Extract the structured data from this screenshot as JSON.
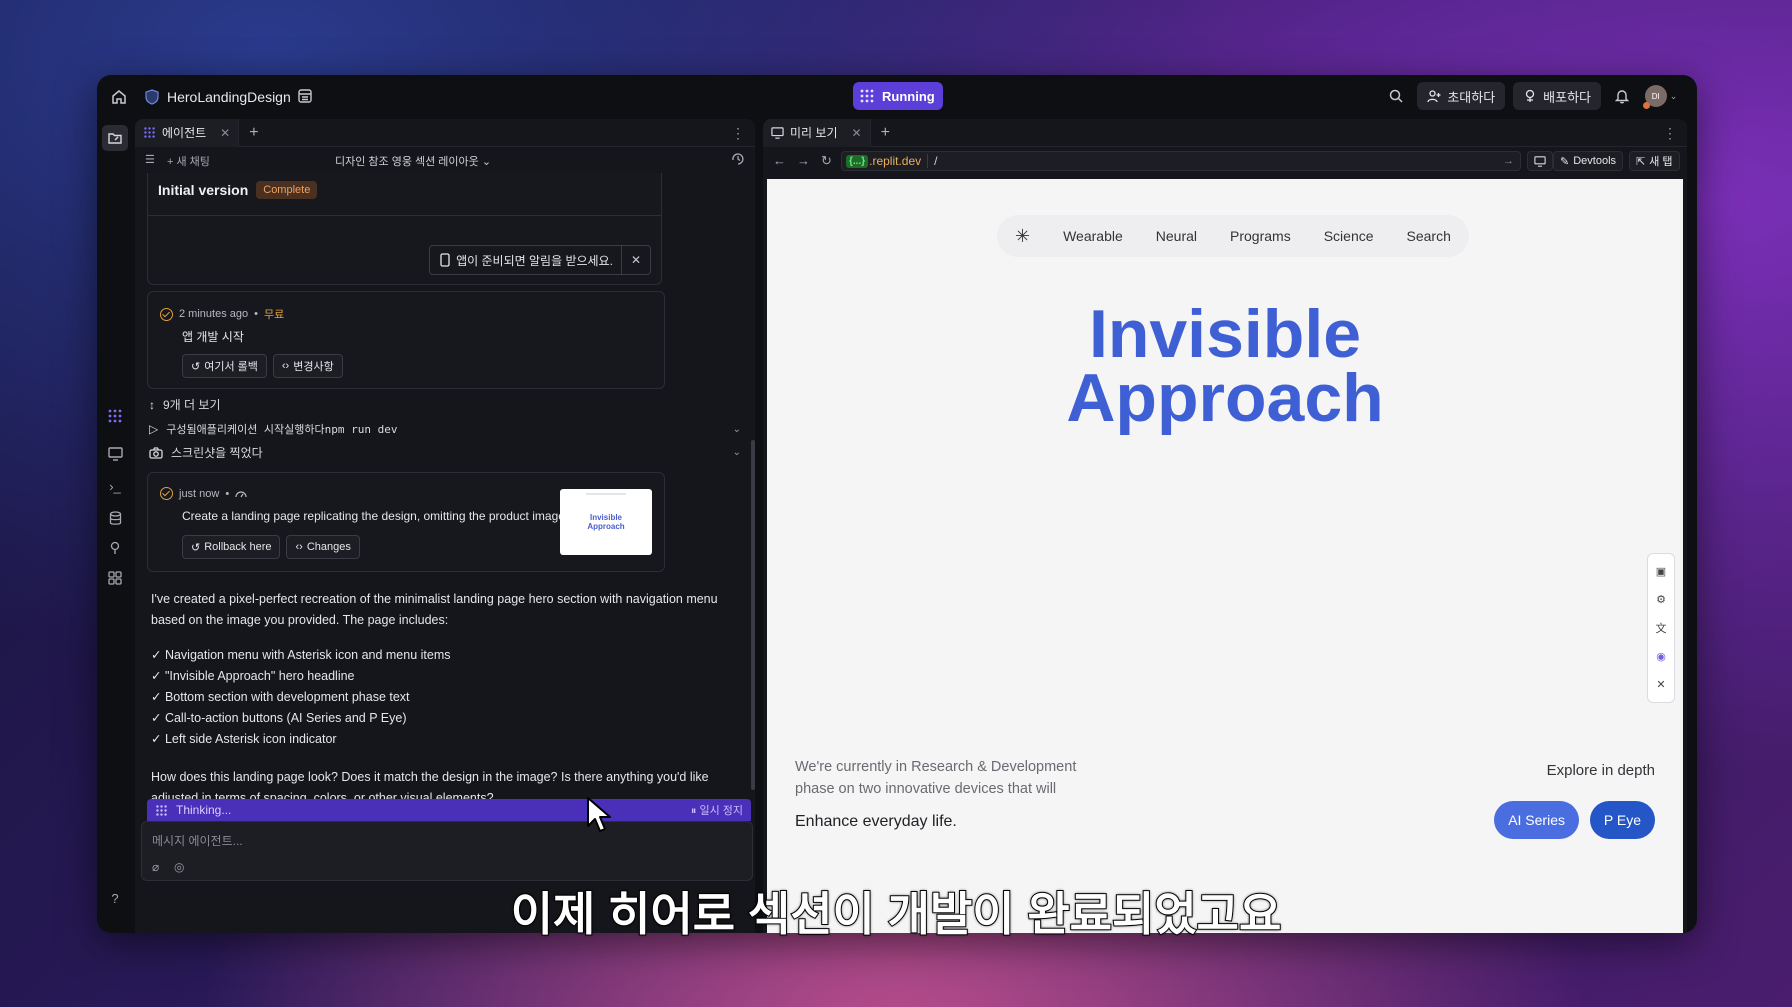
{
  "topbar": {
    "project_name": "HeroLandingDesign",
    "run_label": "Running",
    "invite_label": "초대하다",
    "deploy_label": "배포하다",
    "avatar_initials": "DI"
  },
  "agent_panel": {
    "tab_label": "에이전트",
    "new_chat_label": "+ 새 채팅",
    "chat_title": "디자인 참조 영웅 섹션 레이아웃",
    "initial_version": {
      "title": "Initial version",
      "badge": "Complete",
      "notify_label": "앱이 준비되면 알림을 받으세요."
    },
    "checkpoint_1": {
      "time": "2 minutes ago",
      "cost": "무료",
      "description": "앱 개발 시작",
      "rollback_label": "여기서 롤백",
      "changes_label": "변경사항"
    },
    "show_more_label": "9개 더 보기",
    "action_1": "구성됨애플리케이션 시작실행하다npm run dev",
    "action_2": "스크린샷을 찍었다",
    "checkpoint_2": {
      "time": "just now",
      "description": "Create a landing page replicating the design, omitting the product image",
      "rollback_label": "Rollback here",
      "changes_label": "Changes",
      "thumb_text_1": "Invisible",
      "thumb_text_2": "Approach"
    },
    "message_intro": "I've created a pixel-perfect recreation of the minimalist landing page hero section with navigation menu based on the image you provided. The page includes:",
    "message_items": [
      "✓ Navigation menu with Asterisk icon and menu items",
      "✓ \"Invisible Approach\" hero headline",
      "✓ Bottom section with development phase text",
      "✓ Call-to-action buttons (AI Series and P Eye)",
      "✓ Left side Asterisk icon indicator"
    ],
    "message_question": "How does this landing page look? Does it match the design in the image? Is there anything you'd like adjusted in terms of spacing, colors, or other visual elements?",
    "thinking_label": "Thinking...",
    "pause_label": "⏸ 일시 정지",
    "input_placeholder": "메시지 에이전트..."
  },
  "preview_panel": {
    "tab_label": "미리 보기",
    "url_badge": "{...}",
    "url_host": ".replit.dev",
    "url_path": "/",
    "devtools_label": "Devtools",
    "new_tab_label": "새 탭"
  },
  "site": {
    "nav_items": [
      "Wearable",
      "Neural",
      "Programs",
      "Science",
      "Search"
    ],
    "hero_line_1": "Invisible",
    "hero_line_2": "Approach",
    "desc_line_1": "We're currently in Research & Development",
    "desc_line_2": "phase on two innovative devices that will",
    "strong_line": "Enhance everyday life.",
    "explore_label": "Explore in depth",
    "cta_1": "AI Series",
    "cta_2": "P Eye",
    "colors": {
      "hero": "#3f5fd4",
      "cta_1": "#4a6de0",
      "cta_2": "#2456c8"
    }
  },
  "subtitle": "이제 히어로 섹션이 개발이 완료되었고요"
}
